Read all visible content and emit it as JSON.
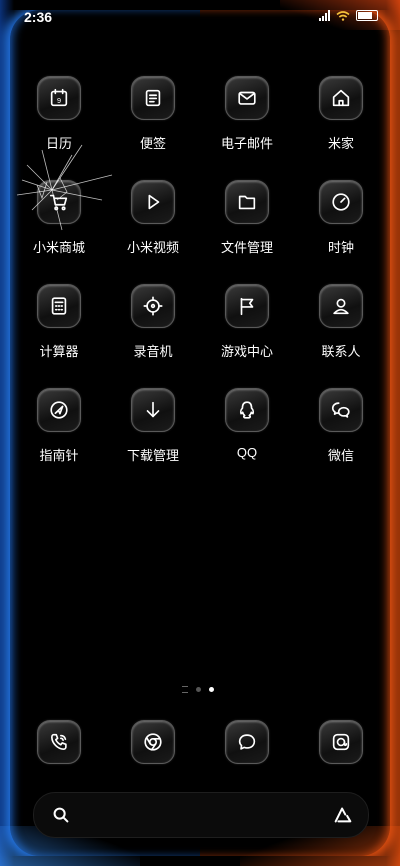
{
  "status_bar": {
    "time": "2:36"
  },
  "apps": [
    {
      "label": "日历",
      "icon": "calendar-icon",
      "badge": "9"
    },
    {
      "label": "便签",
      "icon": "notes-icon"
    },
    {
      "label": "电子邮件",
      "icon": "mail-icon"
    },
    {
      "label": "米家",
      "icon": "home-icon"
    },
    {
      "label": "小米商城",
      "icon": "cart-icon"
    },
    {
      "label": "小米视频",
      "icon": "play-icon"
    },
    {
      "label": "文件管理",
      "icon": "folder-icon"
    },
    {
      "label": "时钟",
      "icon": "clock-icon"
    },
    {
      "label": "计算器",
      "icon": "calculator-icon"
    },
    {
      "label": "录音机",
      "icon": "recorder-icon"
    },
    {
      "label": "游戏中心",
      "icon": "flag-icon"
    },
    {
      "label": "联系人",
      "icon": "contact-icon"
    },
    {
      "label": "指南针",
      "icon": "compass-icon"
    },
    {
      "label": "下载管理",
      "icon": "download-icon"
    },
    {
      "label": "QQ",
      "icon": "qq-icon"
    },
    {
      "label": "微信",
      "icon": "wechat-icon"
    }
  ],
  "dock": [
    {
      "icon": "phone-icon"
    },
    {
      "icon": "browser-icon"
    },
    {
      "icon": "message-icon"
    },
    {
      "icon": "camera-icon"
    }
  ],
  "page_indicator": {
    "pages": 3,
    "current": 3
  },
  "colors": {
    "left_glow": "#2882ff",
    "right_glow": "#ff5a14",
    "background": "#000000"
  }
}
